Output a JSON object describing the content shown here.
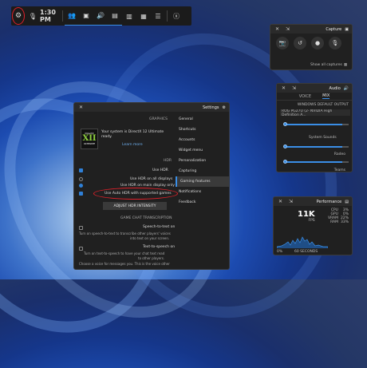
{
  "topbar": {
    "time": "1:30 PM",
    "icons": [
      "settings-icon",
      "mute-icon",
      "xbox-social-icon",
      "capture-icon",
      "audio-icon",
      "performance-icon",
      "resources-icon",
      "gallery-icon",
      "xbox-icon",
      "widgets-icon"
    ]
  },
  "capture": {
    "title": "Capture",
    "show_all": "Show all captures"
  },
  "audio": {
    "title": "Audio",
    "tabs": [
      "MIX",
      "VOICE"
    ],
    "section": "WINDOWS DEFAULT OUTPUT",
    "device": "ROG PG27U (2- NVIDIA High Definition A...",
    "system_sounds": "System Sounds",
    "apps": [
      "Radeo",
      "Teams"
    ]
  },
  "performance": {
    "title": "Performance",
    "labels": [
      "CPU",
      "GPU",
      "VRAM",
      "RAM"
    ],
    "values": [
      "3%",
      "0%",
      "22%",
      "33%"
    ],
    "fps_label": "FPS",
    "fps": "11K",
    "footer": "60 SECONDS",
    "footer_value": "0%"
  },
  "settings": {
    "title": "Settings",
    "nav": [
      "General",
      "Shortcuts",
      "Accounts",
      "Widget menu",
      "Personalization",
      "Capturing",
      "Gaming features",
      "Notifications",
      "Feedback"
    ],
    "selected_nav": "Gaming features",
    "graphics_header": "GRAPHICS",
    "promo_text": "Your system is DirectX 12 Ultimate ready.",
    "learn_more": "Learn more",
    "dx_badge_line1": "DirectX",
    "dx_badge_line2": "XII",
    "dx_badge_line3": "ULTIMATE",
    "hdr_header": "HDR",
    "use_hdr": "Use HDR",
    "hdr_all": "Use HDR on all displays",
    "hdr_main": "Use HDR on main display only",
    "auto_hdr": "Use Auto HDR with supported games",
    "adjust_btn": "ADJUST HDR INTENSITY",
    "transcription_header": "GAME CHAT TRANSCRIPTION",
    "stt_label": "Speech-to-text on",
    "stt_desc1": "Turn on speech-to-text to transcribe other players' voices",
    "stt_desc2": "into text on your screen.",
    "tts_label": "Text-to-speech on",
    "tts_desc1": "Turn on text-to-speech to have your chat text read",
    "tts_desc2": "to other players.",
    "tts_desc3": "Choose a voice for messages you. This is the voice other"
  },
  "colors": {
    "accent": "#3a8ee6",
    "highlight_ring": "#e0202a"
  }
}
